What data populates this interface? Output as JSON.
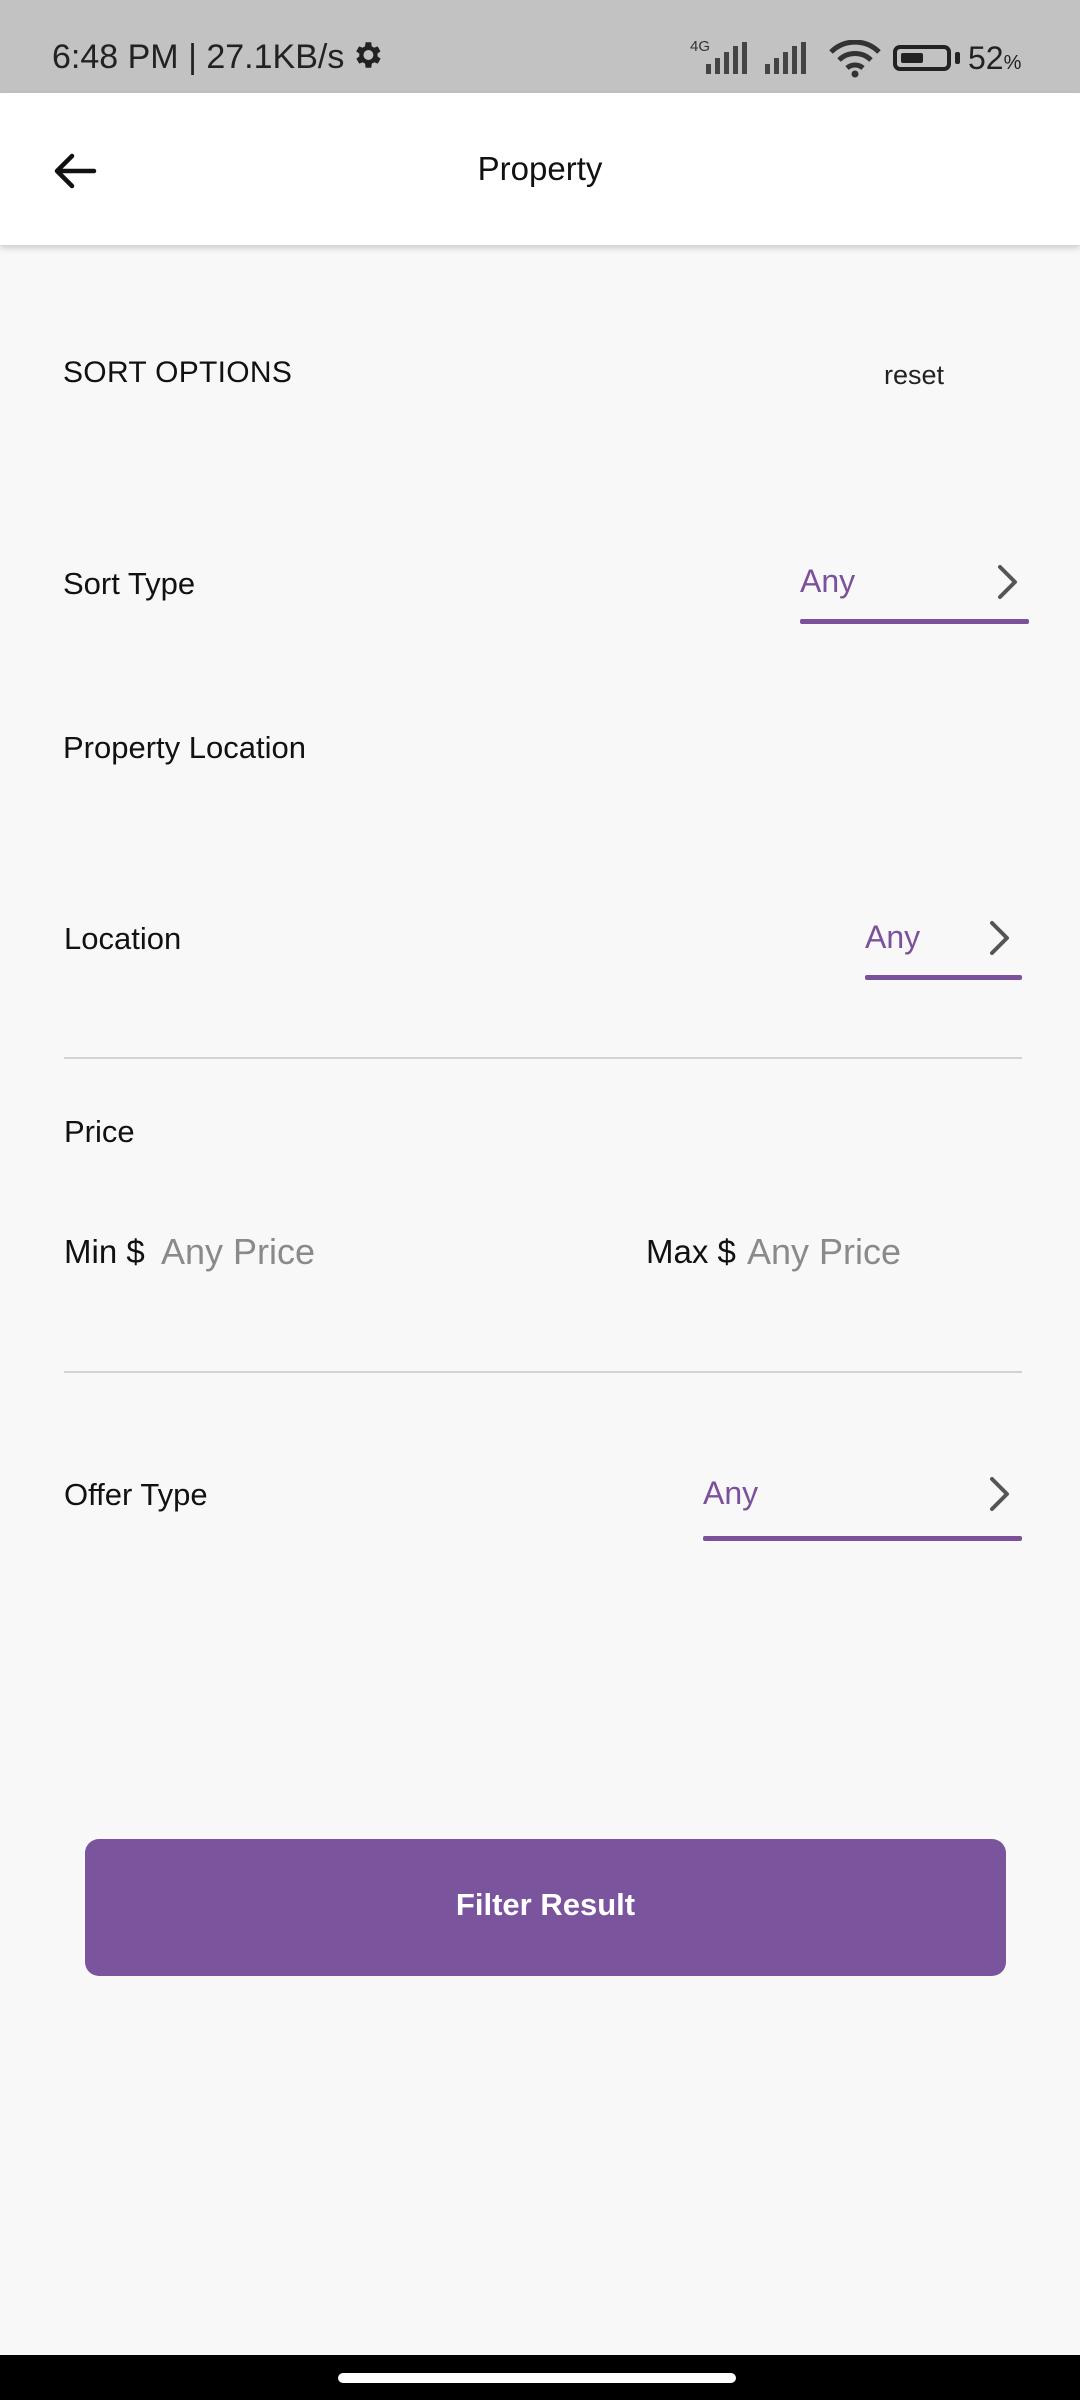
{
  "status": {
    "time_speed": "6:48 PM | 27.1KB/s",
    "network": "4G",
    "battery_value": 52,
    "battery": "52",
    "battery_unit": "%"
  },
  "header": {
    "title": "Property"
  },
  "sort": {
    "heading": "SORT OPTIONS",
    "reset": "reset",
    "type_label": "Sort Type",
    "type_value": "Any"
  },
  "location": {
    "heading": "Property Location",
    "label": "Location",
    "value": "Any"
  },
  "price": {
    "heading": "Price",
    "min_label": "Min $",
    "min_placeholder": "Any Price",
    "max_label": "Max $",
    "max_placeholder": "Any Price"
  },
  "offer": {
    "label": "Offer Type",
    "value": "Any"
  },
  "action": {
    "filter_label": "Filter Result"
  },
  "colors": {
    "accent": "#7b519c",
    "button": "#7b549e",
    "statusbar": "#c2c2c2",
    "background": "#f8f8f8"
  },
  "icons": [
    "settings-icon",
    "signal-icon",
    "wifi-icon",
    "battery-icon",
    "back-arrow-icon",
    "chevron-right-icon"
  ]
}
